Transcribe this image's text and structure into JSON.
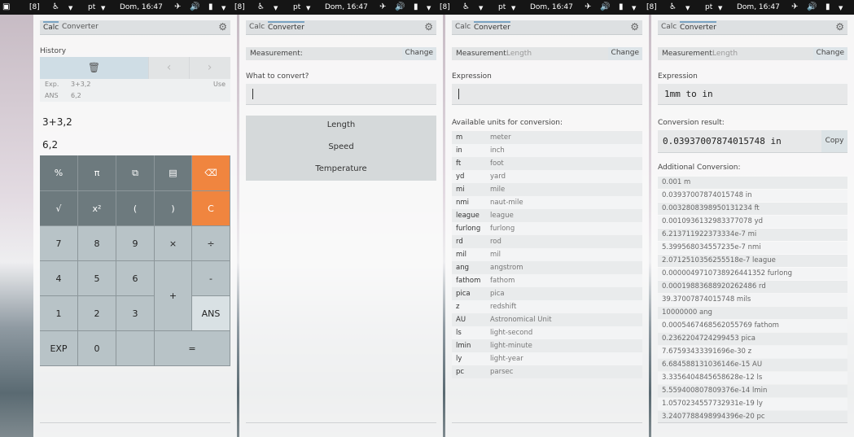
{
  "topbar": {
    "workspace": "[8]",
    "keyboard": "pt",
    "datetime": "Dom, 16:47"
  },
  "calc_panel": {
    "tabs": [
      "Calc",
      "Converter"
    ],
    "history_label": "History",
    "history_rows": [
      {
        "key": "Exp.",
        "value": "3+3,2",
        "action": "Use"
      },
      {
        "key": "ANS",
        "value": "6,2"
      }
    ],
    "expression": "3+3,2",
    "result": "6,2",
    "keys": {
      "percent": "%",
      "pi": "π",
      "copy": "⧉",
      "paste": "📋",
      "backspace": "⌫",
      "sqrt": "√",
      "square": "x²",
      "lparen": "(",
      "rparen": ")",
      "clear": "C",
      "k7": "7",
      "k8": "8",
      "k9": "9",
      "mul": "×",
      "div": "÷",
      "k4": "4",
      "k5": "5",
      "k6": "6",
      "plus": "+",
      "minus": "-",
      "k1": "1",
      "k2": "2",
      "k3": "3",
      "ans": "ANS",
      "exp": "EXP",
      "k0": "0",
      "equals": "="
    }
  },
  "conv_panel1": {
    "tabs": [
      "Calc",
      "Converter"
    ],
    "measurement_label": "Measurement:",
    "measurement_placeholder": "",
    "change": "Change",
    "what_label": "What to convert?",
    "options": [
      "Length",
      "Speed",
      "Temperature"
    ]
  },
  "conv_panel2": {
    "tabs": [
      "Calc",
      "Converter"
    ],
    "measurement_label": "Measurement:",
    "measurement_value": "Length",
    "change": "Change",
    "expression_label": "Expression",
    "available_label": "Available units for conversion:",
    "units": [
      {
        "s": "m",
        "n": "meter"
      },
      {
        "s": "in",
        "n": "inch"
      },
      {
        "s": "ft",
        "n": "foot"
      },
      {
        "s": "yd",
        "n": "yard"
      },
      {
        "s": "mi",
        "n": "mile"
      },
      {
        "s": "nmi",
        "n": "naut-mile"
      },
      {
        "s": "league",
        "n": "league"
      },
      {
        "s": "furlong",
        "n": "furlong"
      },
      {
        "s": "rd",
        "n": "rod"
      },
      {
        "s": "mil",
        "n": "mil"
      },
      {
        "s": "ang",
        "n": "angstrom"
      },
      {
        "s": "fathom",
        "n": "fathom"
      },
      {
        "s": "pica",
        "n": "pica"
      },
      {
        "s": "z",
        "n": "redshift"
      },
      {
        "s": "AU",
        "n": "Astronomical Unit"
      },
      {
        "s": "ls",
        "n": "light-second"
      },
      {
        "s": "lmin",
        "n": "light-minute"
      },
      {
        "s": "ly",
        "n": "light-year"
      },
      {
        "s": "pc",
        "n": "parsec"
      }
    ]
  },
  "conv_panel3": {
    "tabs": [
      "Calc",
      "Converter"
    ],
    "measurement_label": "Measurement:",
    "measurement_value": "Length",
    "change": "Change",
    "expression_label": "Expression",
    "expression_value": "1mm to in",
    "result_label": "Conversion result:",
    "result_value": "0.03937007874015748 in",
    "copy": "Copy",
    "additional_label": "Additional Conversion:",
    "additional": [
      "0.001 m",
      "0.03937007874015748 in",
      "0.0032808398950131234 ft",
      "0.0010936132983377078 yd",
      "6.213711922373334e-7 mi",
      "5.399568034557235e-7 nmi",
      "2.0712510356255518e-7 league",
      "0.0000049710738926441352 furlong",
      "0.00019883688920262486 rd",
      "39.37007874015748 mils",
      "10000000 ang",
      "0.0005467468562055769 fathom",
      "0.2362204724299453 pica",
      "7.67593433391696e-30 z",
      "6.684588131036146e-15 AU",
      "3.3356404845658628e-12 ls",
      "5.559400807809376e-14 lmin",
      "1.0570234557732931e-19 ly",
      "3.2407788498994396e-20 pc"
    ]
  }
}
